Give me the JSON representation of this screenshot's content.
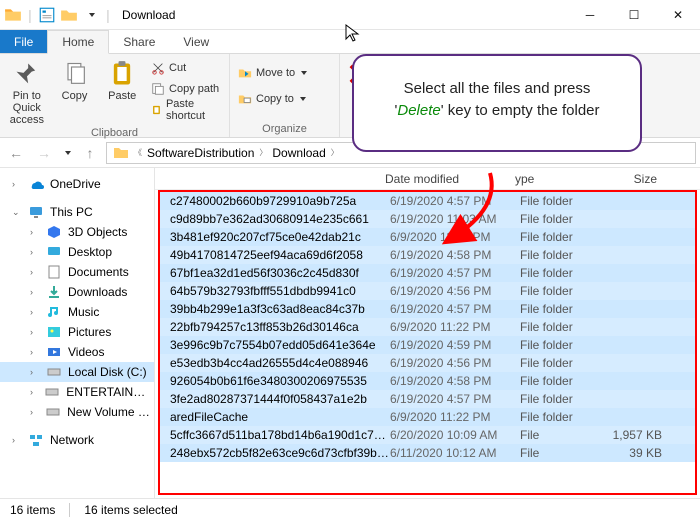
{
  "window": {
    "title": "Download",
    "tabs": {
      "file": "File",
      "home": "Home",
      "share": "Share",
      "view": "View"
    }
  },
  "ribbon": {
    "clipboard": {
      "label": "Clipboard",
      "pin": "Pin to Quick access",
      "copy": "Copy",
      "paste": "Paste",
      "cut": "Cut",
      "copy_path": "Copy path",
      "paste_shortcut": "Paste shortcut"
    },
    "organize": {
      "label": "Organize",
      "move_to": "Move to",
      "copy_to": "Copy to"
    }
  },
  "breadcrumb": {
    "part1": "SoftwareDistribution",
    "part2": "Download"
  },
  "nav": {
    "onedrive": "OneDrive",
    "this_pc": "This PC",
    "d3": "3D Objects",
    "desktop": "Desktop",
    "documents": "Documents",
    "downloads": "Downloads",
    "music": "Music",
    "pictures": "Pictures",
    "videos": "Videos",
    "local_c": "Local Disk (C:)",
    "entertainment": "ENTERTAINMENT",
    "new_vol": "New Volume (H:)",
    "network": "Network"
  },
  "columns": {
    "date": "Date modified",
    "type": "ype",
    "size": "Size"
  },
  "files": [
    {
      "name": "c27480002b660b9729910a9b725a",
      "date": "6/19/2020 4:57 PM",
      "type": "File folder",
      "size": ""
    },
    {
      "name": "c9d89bb7e362ad30680914e235c661",
      "date": "6/19/2020 11:03 AM",
      "type": "File folder",
      "size": ""
    },
    {
      "name": "3b481ef920c207cf75ce0e42dab21c",
      "date": "6/9/2020 11:27 PM",
      "type": "File folder",
      "size": ""
    },
    {
      "name": "49b4170814725eef94aca69d6f2058",
      "date": "6/19/2020 4:58 PM",
      "type": "File folder",
      "size": ""
    },
    {
      "name": "67bf1ea32d1ed56f3036c2c45d830f",
      "date": "6/19/2020 4:57 PM",
      "type": "File folder",
      "size": ""
    },
    {
      "name": "64b579b32793fbfff551dbdb9941c0",
      "date": "6/19/2020 4:56 PM",
      "type": "File folder",
      "size": ""
    },
    {
      "name": "39bb4b299e1a3f3c63ad8eac84c37b",
      "date": "6/19/2020 4:57 PM",
      "type": "File folder",
      "size": ""
    },
    {
      "name": "22bfb794257c13ff853b26d30146ca",
      "date": "6/9/2020 11:22 PM",
      "type": "File folder",
      "size": ""
    },
    {
      "name": "3e996c9b7c7554b07edd05d641e364e",
      "date": "6/19/2020 4:59 PM",
      "type": "File folder",
      "size": ""
    },
    {
      "name": "e53edb3b4cc4ad26555d4c4e088946",
      "date": "6/19/2020 4:56 PM",
      "type": "File folder",
      "size": ""
    },
    {
      "name": "926054b0b61f6e348030020697553​5",
      "date": "6/19/2020 4:58 PM",
      "type": "File folder",
      "size": ""
    },
    {
      "name": "3fe2ad80287371444f0f058437a1e2b",
      "date": "6/19/2020 4:57 PM",
      "type": "File folder",
      "size": ""
    },
    {
      "name": "aredFileCache",
      "date": "6/9/2020 11:22 PM",
      "type": "File folder",
      "size": ""
    },
    {
      "name": "5cffc3667d511ba178bd14b6a190d1c74...",
      "date": "6/20/2020 10:09 AM",
      "type": "File",
      "size": "1,957 KB"
    },
    {
      "name": "248ebx572cb5f82e63ce9c6d73cfbf39b10...",
      "date": "6/11/2020 10:12 AM",
      "type": "File",
      "size": "39 KB"
    }
  ],
  "status": {
    "count": "16 items",
    "selected": "16 items selected"
  },
  "callout": {
    "line1": "Select all the files and press",
    "delete": "Delete",
    "line2": "' key to empty the folder"
  }
}
